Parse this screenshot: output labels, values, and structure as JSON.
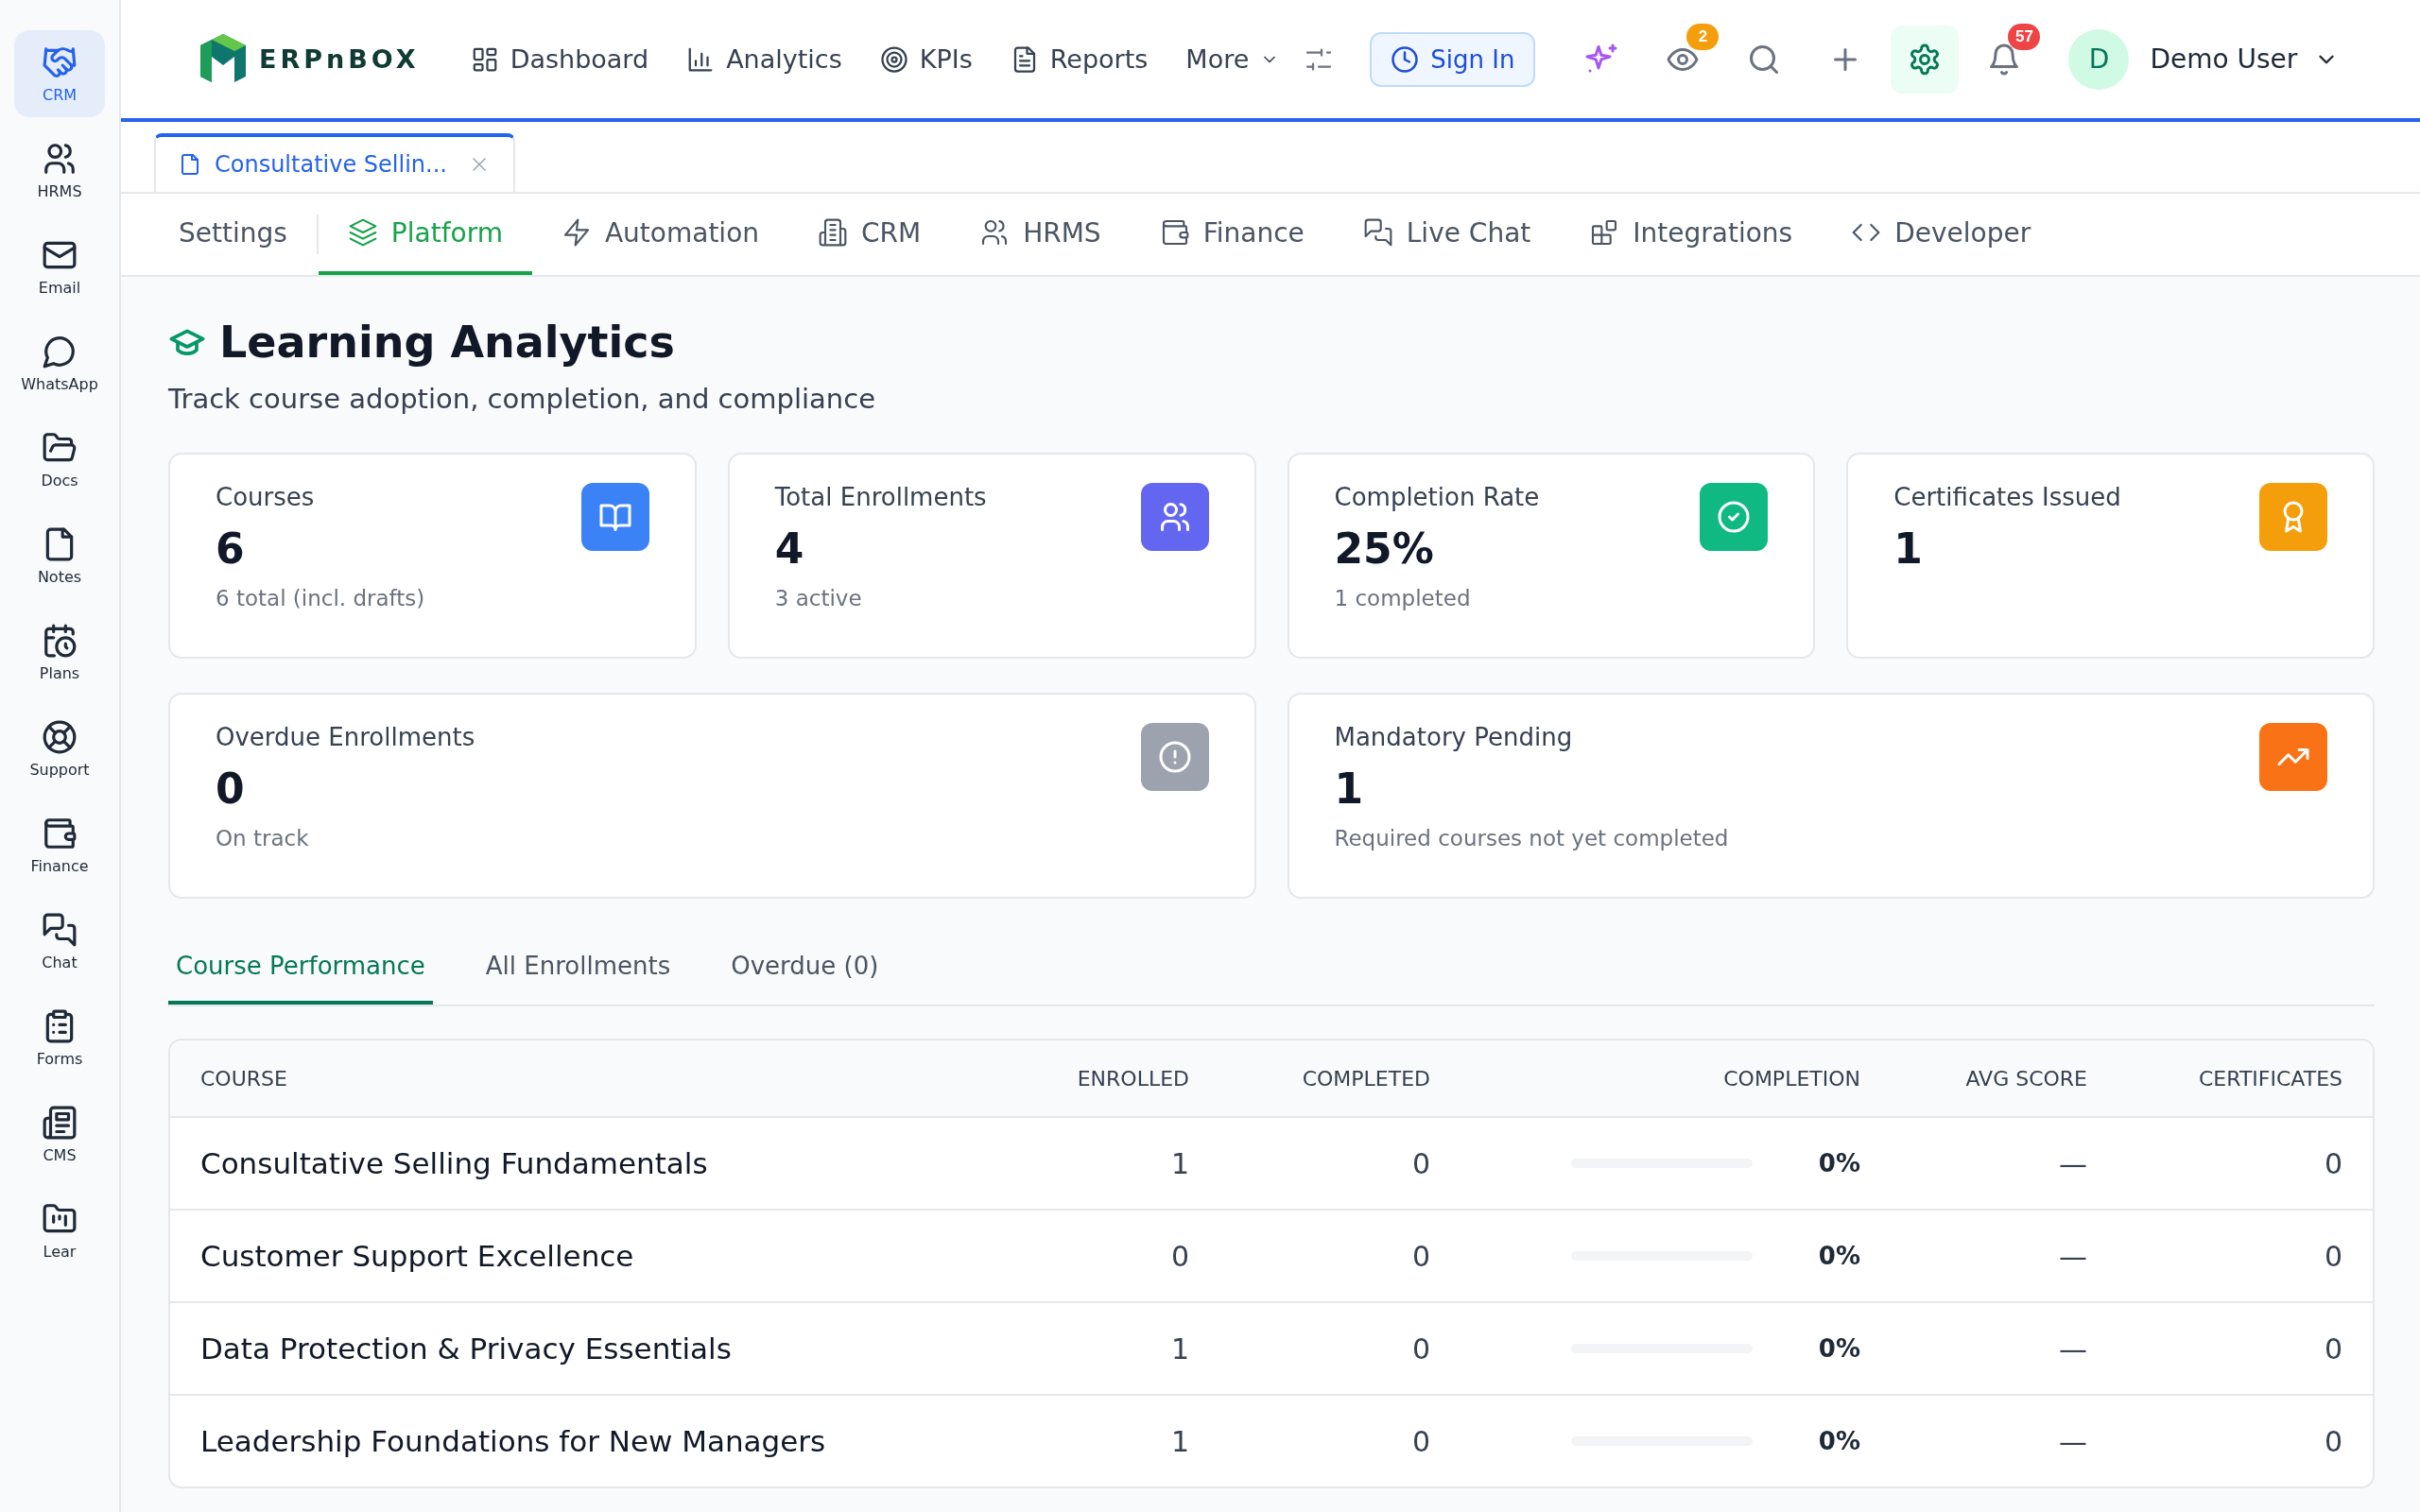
{
  "sidebar": {
    "items": [
      {
        "label": "CRM",
        "selected": true
      },
      {
        "label": "HRMS",
        "selected": false
      },
      {
        "label": "Email",
        "selected": false
      },
      {
        "label": "WhatsApp",
        "selected": false
      },
      {
        "label": "Docs",
        "selected": false
      },
      {
        "label": "Notes",
        "selected": false
      },
      {
        "label": "Plans",
        "selected": false
      },
      {
        "label": "Support",
        "selected": false
      },
      {
        "label": "Finance",
        "selected": false
      },
      {
        "label": "Chat",
        "selected": false
      },
      {
        "label": "Forms",
        "selected": false
      },
      {
        "label": "CMS",
        "selected": false
      },
      {
        "label": "Lear",
        "selected": false
      }
    ]
  },
  "topbar": {
    "logo": "ERPnBOX",
    "nav": [
      {
        "label": "Dashboard"
      },
      {
        "label": "Analytics"
      },
      {
        "label": "KPIs"
      },
      {
        "label": "Reports"
      }
    ],
    "more": "More",
    "sign_in": "Sign In",
    "watch_badge": "2",
    "notification_badge": "57",
    "avatar": "D",
    "user": "Demo User"
  },
  "doc_tabs": [
    {
      "label": "Consultative Sellin...",
      "selected": true
    }
  ],
  "settings_tabs": [
    {
      "label": "Settings",
      "selected": false
    },
    {
      "label": "Platform",
      "selected": true
    },
    {
      "label": "Automation",
      "selected": false
    },
    {
      "label": "CRM",
      "selected": false
    },
    {
      "label": "HRMS",
      "selected": false
    },
    {
      "label": "Finance",
      "selected": false
    },
    {
      "label": "Live Chat",
      "selected": false
    },
    {
      "label": "Integrations",
      "selected": false
    },
    {
      "label": "Developer",
      "selected": false
    }
  ],
  "page": {
    "title": "Learning Analytics",
    "subtitle": "Track course adoption, completion, and compliance"
  },
  "stats": [
    {
      "label": "Courses",
      "value": "6",
      "note": "6 total (incl. drafts)",
      "color": "#3b82f6"
    },
    {
      "label": "Total Enrollments",
      "value": "4",
      "note": "3 active",
      "color": "#6366f1"
    },
    {
      "label": "Completion Rate",
      "value": "25%",
      "note": "1 completed",
      "color": "#10b981"
    },
    {
      "label": "Certificates Issued",
      "value": "1",
      "color": "#f59e0b"
    },
    {
      "label": "Overdue Enrollments",
      "value": "0",
      "note": "On track",
      "color": "#9ca3af"
    },
    {
      "label": "Mandatory Pending",
      "value": "1",
      "note": "Required courses not yet completed",
      "color": "#f97316"
    }
  ],
  "content_tabs": [
    {
      "label": "Course Performance",
      "selected": true
    },
    {
      "label": "All Enrollments",
      "selected": false
    },
    {
      "label": "Overdue (0)",
      "selected": false
    }
  ],
  "table": {
    "columns": [
      "COURSE",
      "ENROLLED",
      "COMPLETED",
      "COMPLETION",
      "AVG SCORE",
      "CERTIFICATES"
    ],
    "rows": [
      {
        "course": "Consultative Selling Fundamentals",
        "enrolled": "1",
        "completed": "0",
        "level": 0,
        "completion": "0%",
        "avg_score": "—",
        "certificates": "0"
      },
      {
        "course": "Customer Support Excellence",
        "enrolled": "0",
        "completed": "0",
        "level": 0,
        "completion": "0%",
        "avg_score": "—",
        "certificates": "0"
      },
      {
        "course": "Data Protection & Privacy Essentials",
        "enrolled": "1",
        "completed": "0",
        "level": 0,
        "completion": "0%",
        "avg_score": "—",
        "certificates": "0"
      },
      {
        "course": "Leadership Foundations for New Managers",
        "enrolled": "1",
        "completed": "0",
        "level": 0,
        "completion": "0%",
        "avg_score": "—",
        "certificates": "0"
      }
    ]
  }
}
